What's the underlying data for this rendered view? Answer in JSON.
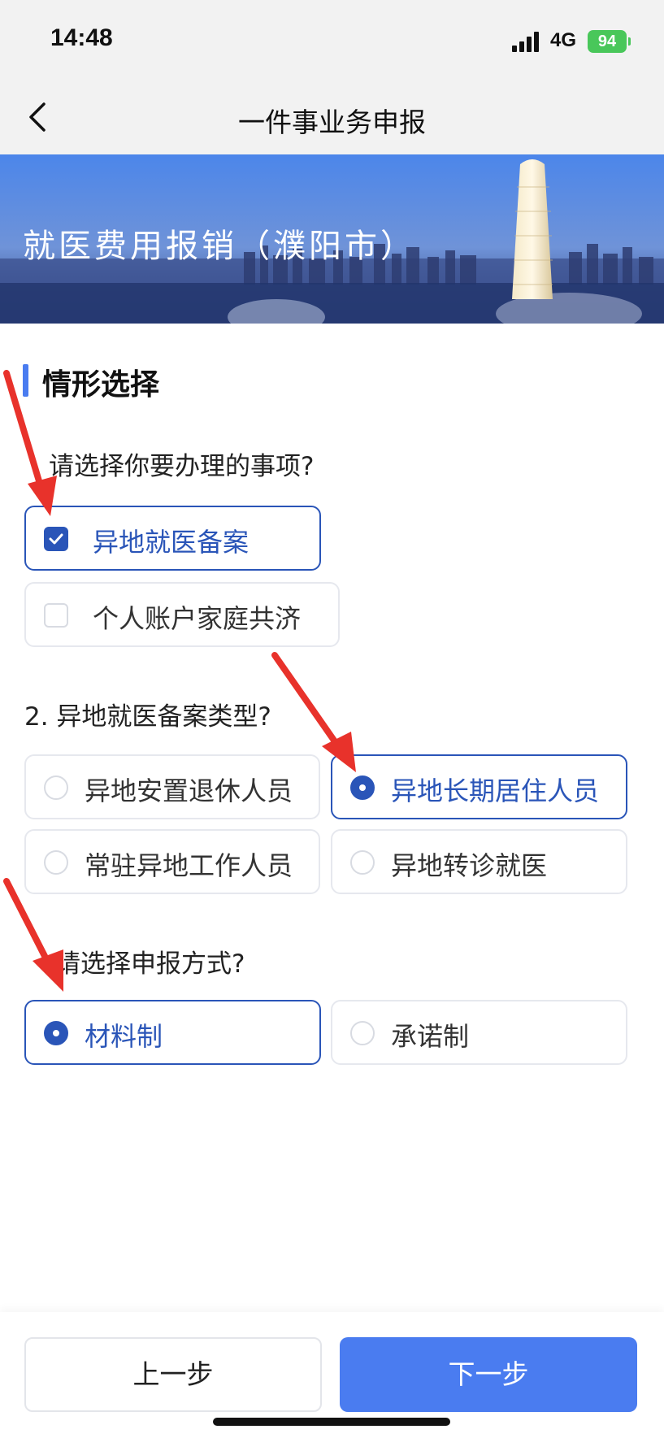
{
  "status": {
    "time": "14:48",
    "network": "4G",
    "battery": "94"
  },
  "nav": {
    "title": "一件事业务申报"
  },
  "banner": {
    "title": "就医费用报销（濮阳市）"
  },
  "section": {
    "title": "情形选择"
  },
  "q1": {
    "text": "请选择你要办理的事项?",
    "options": [
      {
        "label": "异地就医备案",
        "checked": true
      },
      {
        "label": "个人账户家庭共济",
        "checked": false
      }
    ]
  },
  "q2": {
    "text": "2. 异地就医备案类型?",
    "options": [
      {
        "label": "异地安置退休人员",
        "checked": false
      },
      {
        "label": "异地长期居住人员",
        "checked": true
      },
      {
        "label": "常驻异地工作人员",
        "checked": false
      },
      {
        "label": "异地转诊就医",
        "checked": false
      }
    ]
  },
  "q3": {
    "text": "请选择申报方式?",
    "options": [
      {
        "label": "材料制",
        "checked": true
      },
      {
        "label": "承诺制",
        "checked": false
      }
    ]
  },
  "footer": {
    "prev_label": "上一步",
    "next_label": "下一步"
  },
  "colors": {
    "accent": "#2a55b8",
    "primary_button": "#4a7cf0",
    "arrow": "#e8322b"
  }
}
